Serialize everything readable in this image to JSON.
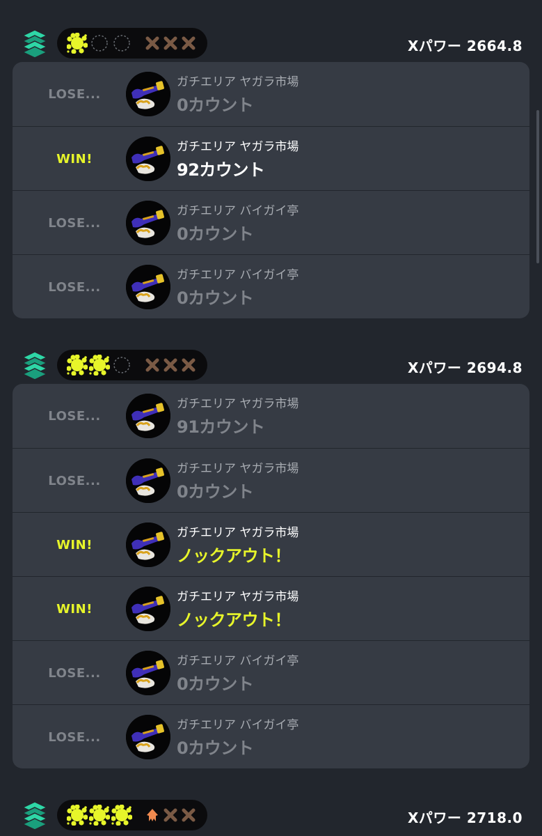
{
  "colors": {
    "background": "#22262d",
    "card": "#363b44",
    "win_yellow": "#e7f52a",
    "lose_gray": "#80848b",
    "splat_zones_teal": "#2ed6a6",
    "squid_orange": "#f08a4f"
  },
  "sessions": [
    {
      "mode_icon": "splat-zones-icon",
      "wins": 1,
      "losses": 3,
      "xpower": "Xパワー 2664.8",
      "battles": [
        {
          "result": "LOSE...",
          "outcome": "lose",
          "stage": "ガチエリア ヤガラ市場",
          "score": "0カウント",
          "score_type": "lose"
        },
        {
          "result": "WIN!",
          "outcome": "win",
          "stage": "ガチエリア ヤガラ市場",
          "score": "92カウント",
          "score_type": "win-count"
        },
        {
          "result": "LOSE...",
          "outcome": "lose",
          "stage": "ガチエリア バイガイ亭",
          "score": "0カウント",
          "score_type": "lose"
        },
        {
          "result": "LOSE...",
          "outcome": "lose",
          "stage": "ガチエリア バイガイ亭",
          "score": "0カウント",
          "score_type": "lose"
        }
      ]
    },
    {
      "mode_icon": "splat-zones-icon",
      "wins": 2,
      "losses": 3,
      "xpower": "Xパワー 2694.8",
      "battles": [
        {
          "result": "LOSE...",
          "outcome": "lose",
          "stage": "ガチエリア ヤガラ市場",
          "score": "91カウント",
          "score_type": "lose"
        },
        {
          "result": "LOSE...",
          "outcome": "lose",
          "stage": "ガチエリア ヤガラ市場",
          "score": "0カウント",
          "score_type": "lose"
        },
        {
          "result": "WIN!",
          "outcome": "win",
          "stage": "ガチエリア ヤガラ市場",
          "score": "ノックアウト！",
          "score_type": "ko"
        },
        {
          "result": "WIN!",
          "outcome": "win",
          "stage": "ガチエリア ヤガラ市場",
          "score": "ノックアウト！",
          "score_type": "ko"
        },
        {
          "result": "LOSE...",
          "outcome": "lose",
          "stage": "ガチエリア バイガイ亭",
          "score": "0カウント",
          "score_type": "lose"
        },
        {
          "result": "LOSE...",
          "outcome": "lose",
          "stage": "ガチエリア バイガイ亭",
          "score": "0カウント",
          "score_type": "lose"
        }
      ]
    },
    {
      "mode_icon": "splat-zones-icon",
      "wins": 3,
      "losses": 2,
      "xpower": "Xパワー 2718.0",
      "battles": []
    }
  ]
}
